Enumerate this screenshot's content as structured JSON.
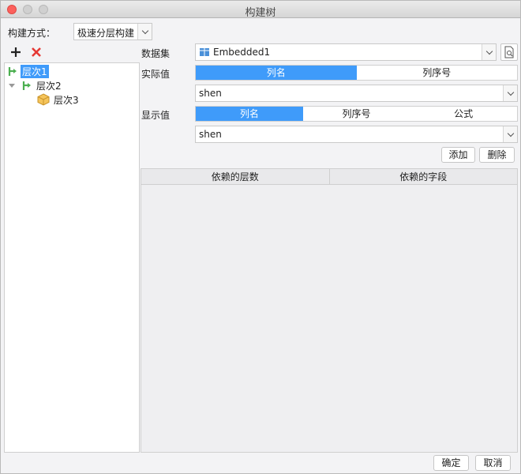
{
  "window": {
    "title": "构建树"
  },
  "build_mode": {
    "label": "构建方式：",
    "value": "极速分层构建"
  },
  "toolbar": {
    "add_icon": "plus-icon",
    "delete_icon": "close-icon"
  },
  "tree": {
    "items": [
      {
        "label": "层次1",
        "icon": "branch-icon",
        "selected": true
      },
      {
        "label": "层次2",
        "icon": "branch-icon",
        "expanded": true
      },
      {
        "label": "层次3",
        "icon": "box-icon"
      }
    ]
  },
  "dataset": {
    "label": "数据集",
    "value": "Embedded1"
  },
  "actual_value": {
    "label": "实际值",
    "options": [
      "列名",
      "列序号"
    ],
    "selected": "列名",
    "field": "shen"
  },
  "display_value": {
    "label": "显示值",
    "options": [
      "列名",
      "列序号",
      "公式"
    ],
    "selected": "列名",
    "field": "shen"
  },
  "buttons": {
    "add": "添加",
    "delete": "删除",
    "ok": "确定",
    "cancel": "取消"
  },
  "dependency_table": {
    "columns": [
      "依赖的层数",
      "依赖的字段"
    ],
    "rows": []
  },
  "colors": {
    "accent": "#3f9bfa",
    "close": "#fc605c",
    "green": "#4caf50"
  }
}
